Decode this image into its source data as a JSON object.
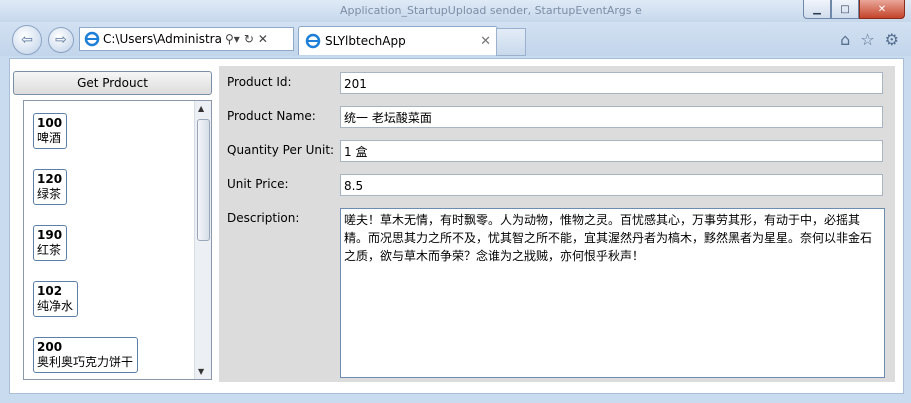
{
  "window": {
    "title": "Application_StartupUpload sender, StartupEventArgs e"
  },
  "browser": {
    "address": "C:\\Users\\Administra",
    "tab_title": "SLYlbtechApp"
  },
  "left": {
    "get_button_label": "Get Prdouct",
    "items": [
      {
        "id": "100",
        "name": "啤酒"
      },
      {
        "id": "120",
        "name": "绿茶"
      },
      {
        "id": "190",
        "name": "红茶"
      },
      {
        "id": "102",
        "name": "纯净水"
      },
      {
        "id": "200",
        "name": "奥利奥巧克力饼干"
      }
    ]
  },
  "form": {
    "product_id_label": "Product Id:",
    "product_id": "201",
    "product_name_label": "Product Name:",
    "product_name": "统一 老坛酸菜面",
    "qty_label": "Quantity Per Unit:",
    "qty": "1 盒",
    "price_label": "Unit Price:",
    "price": "8.5",
    "desc_label": "Description:",
    "desc": "嗟夫！草木无情，有时飘零。人为动物，惟物之灵。百忧感其心，万事劳其形，有动于中，必摇其精。而况思其力之所不及，忧其智之所不能，宜其渥然丹者为槁木，黟然黑者为星星。奈何以非金石之质，欲与草木而争荣？念谁为之戕贼，亦何恨乎秋声！"
  }
}
